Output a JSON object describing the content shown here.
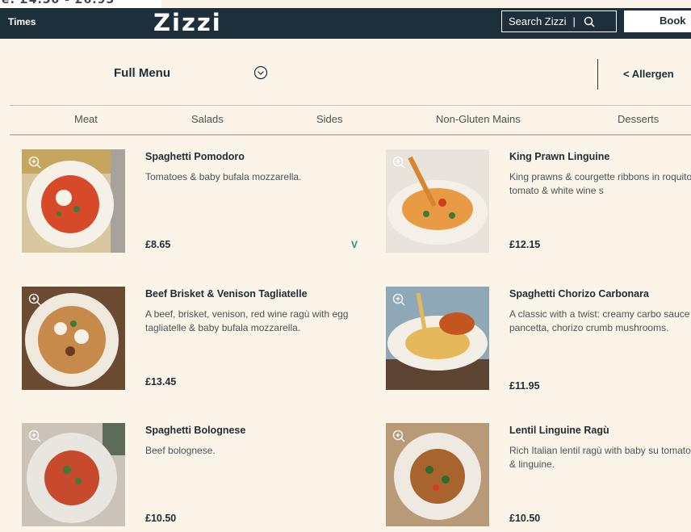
{
  "header": {
    "top_fragment": "e: £4.50 - £6.95",
    "left_text": "Times",
    "logo": "Zizzi",
    "search_label": "Search Zizzi",
    "book_label": "Book",
    "bg_color": "#1c2f3a"
  },
  "menu_bar": {
    "title": "Full Menu",
    "allergen_label": "< Allergen"
  },
  "categories": [
    "Meat",
    "Salads",
    "Sides",
    "Non-Gluten Mains",
    "Desserts"
  ],
  "items": [
    {
      "name": "Spaghetti Pomodoro",
      "desc": "Tomatoes & baby bufala mozzarella.",
      "price": "£8.65",
      "badge": "V"
    },
    {
      "name": "King Prawn Linguine",
      "desc": "King prawns & courgette ribbons in roquito chilli, tomato & white wine s",
      "price": "£12.15",
      "badge": ""
    },
    {
      "name": "Beef Brisket & Venison Tagliatelle",
      "desc": "A beef, brisket, venison, red wine ragù with egg tagliatelle & baby bufala mozzarella.",
      "price": "£13.45",
      "badge": ""
    },
    {
      "name": "Spaghetti Chorizo Carbonara",
      "desc": "A classic with a twist: creamy carbo sauce with pancetta, chorizo crumb mushrooms.",
      "price": "£11.95",
      "badge": ""
    },
    {
      "name": "Spaghetti Bolognese",
      "desc": "Beef bolognese.",
      "price": "£10.50",
      "badge": ""
    },
    {
      "name": "Lentil Linguine Ragù",
      "desc": "Rich Italian lentil ragù with baby su tomatoes, kale & linguine.",
      "price": "£10.50",
      "badge": ""
    }
  ]
}
